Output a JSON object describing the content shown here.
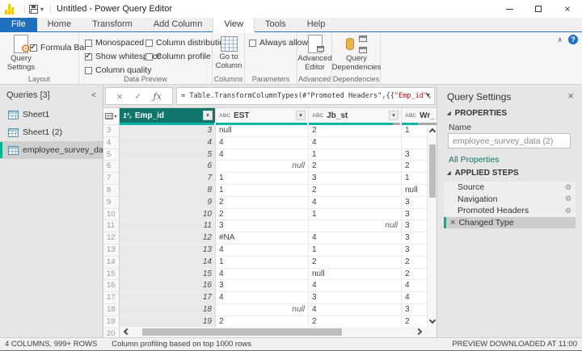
{
  "icons": {
    "dropdown": "▾",
    "check": "✓",
    "cancel": "×",
    "close": "×",
    "fx": "ƒx",
    "gear": "⚙",
    "help": "?",
    "section_triangle": "◢",
    "collapse_left": "<",
    "collapse_ribbon": "∧"
  },
  "title_bar": {
    "title": "Untitled - Power Query Editor"
  },
  "tabs": [
    {
      "label": "File",
      "type": "file"
    },
    {
      "label": "Home"
    },
    {
      "label": "Transform"
    },
    {
      "label": "Add Column"
    },
    {
      "label": "View",
      "active": true
    },
    {
      "label": "Tools"
    },
    {
      "label": "Help"
    }
  ],
  "ribbon": {
    "buttons": {
      "query_settings": "Query Settings",
      "go_to_column": "Go to Column",
      "advanced_editor": "Advanced Editor",
      "query_dependencies": "Query Dependencies"
    },
    "checkboxes": {
      "formula_bar": {
        "label": "Formula Bar",
        "checked": true
      },
      "monospaced": {
        "label": "Monospaced",
        "checked": false
      },
      "show_whitespace": {
        "label": "Show whitespace",
        "checked": true
      },
      "column_quality": {
        "label": "Column quality",
        "checked": false
      },
      "column_distribution": {
        "label": "Column distribution",
        "checked": false
      },
      "column_profile": {
        "label": "Column profile",
        "checked": false
      },
      "always_allow": {
        "label": "Always allow",
        "checked": false
      }
    },
    "groups": {
      "layout": "Layout",
      "data_preview": "Data Preview",
      "columns": "Columns",
      "parameters": "Parameters",
      "advanced": "Advanced",
      "dependencies": "Dependencies"
    }
  },
  "formula_bar": {
    "pre": "= Table.TransformColumnTypes(#\"Promoted Headers\",{{",
    "str": "\"Emp_id\"",
    "post": ", "
  },
  "queries_pane": {
    "header": "Queries [3]",
    "items": [
      {
        "label": "Sheet1",
        "selected": false
      },
      {
        "label": "Sheet1 (2)",
        "selected": false
      },
      {
        "label": "employee_survey_data (2)",
        "selected": true
      }
    ]
  },
  "grid": {
    "columns": [
      {
        "type_icon": "1²₃",
        "name": "Emp_id",
        "selected": true,
        "quality": "full"
      },
      {
        "type_icon": "ABC",
        "name": "EST",
        "quality": "full"
      },
      {
        "type_icon": "ABC",
        "name": "Jb_st",
        "quality": "gray-end"
      },
      {
        "type_icon": "ABC",
        "name": "Wr_",
        "quality": "gray-mid"
      }
    ],
    "rows": [
      {
        "n": "3",
        "emp": "3",
        "cells": [
          {
            "v": "null"
          },
          {
            "v": "2"
          },
          {
            "v": "1"
          }
        ]
      },
      {
        "n": "4",
        "emp": "4",
        "cells": [
          {
            "v": "4"
          },
          {
            "v": "4"
          },
          {
            "v": ""
          }
        ]
      },
      {
        "n": "5",
        "emp": "5",
        "cells": [
          {
            "v": "4"
          },
          {
            "v": "1"
          },
          {
            "v": "3"
          }
        ]
      },
      {
        "n": "6",
        "emp": "6",
        "cells": [
          {
            "v": "null",
            "nul": true
          },
          {
            "v": "2"
          },
          {
            "v": "2"
          }
        ]
      },
      {
        "n": "7",
        "emp": "7",
        "cells": [
          {
            "v": "1"
          },
          {
            "v": "3"
          },
          {
            "v": "1"
          }
        ]
      },
      {
        "n": "8",
        "emp": "8",
        "cells": [
          {
            "v": "1"
          },
          {
            "v": "2"
          },
          {
            "v": "null"
          }
        ]
      },
      {
        "n": "9",
        "emp": "9",
        "cells": [
          {
            "v": "2"
          },
          {
            "v": "4"
          },
          {
            "v": "3"
          }
        ]
      },
      {
        "n": "10",
        "emp": "10",
        "cells": [
          {
            "v": "2"
          },
          {
            "v": "1"
          },
          {
            "v": "3"
          }
        ]
      },
      {
        "n": "11",
        "emp": "11",
        "cells": [
          {
            "v": "3"
          },
          {
            "v": "null",
            "nul": true
          },
          {
            "v": "3"
          }
        ]
      },
      {
        "n": "12",
        "emp": "12",
        "cells": [
          {
            "v": "#NA"
          },
          {
            "v": "4"
          },
          {
            "v": "3"
          }
        ]
      },
      {
        "n": "13",
        "emp": "13",
        "cells": [
          {
            "v": "4"
          },
          {
            "v": "1"
          },
          {
            "v": "3"
          }
        ]
      },
      {
        "n": "14",
        "emp": "14",
        "cells": [
          {
            "v": "1"
          },
          {
            "v": "2"
          },
          {
            "v": "2"
          }
        ]
      },
      {
        "n": "15",
        "emp": "15",
        "cells": [
          {
            "v": "4"
          },
          {
            "v": "null"
          },
          {
            "v": "2"
          }
        ]
      },
      {
        "n": "16",
        "emp": "16",
        "cells": [
          {
            "v": "3"
          },
          {
            "v": "4"
          },
          {
            "v": "4"
          }
        ]
      },
      {
        "n": "17",
        "emp": "17",
        "cells": [
          {
            "v": "4"
          },
          {
            "v": "3"
          },
          {
            "v": "4"
          }
        ]
      },
      {
        "n": "18",
        "emp": "18",
        "cells": [
          {
            "v": "null",
            "nul": true
          },
          {
            "v": "4"
          },
          {
            "v": "3"
          }
        ]
      },
      {
        "n": "19",
        "emp": "19",
        "cells": [
          {
            "v": "2"
          },
          {
            "v": "2"
          },
          {
            "v": "2"
          }
        ]
      },
      {
        "n": "20",
        "emp": "",
        "cells": [
          {
            "v": ""
          },
          {
            "v": ""
          },
          {
            "v": ""
          }
        ]
      }
    ]
  },
  "query_settings": {
    "title": "Query Settings",
    "properties_header": "PROPERTIES",
    "name_label": "Name",
    "name_value": "employee_survey_data (2)",
    "all_properties": "All Properties",
    "applied_steps_header": "APPLIED STEPS",
    "steps": [
      {
        "label": "Source",
        "gear": true
      },
      {
        "label": "Navigation",
        "gear": true
      },
      {
        "label": "Promoted Headers",
        "gear": true
      },
      {
        "label": "Changed Type",
        "selected": true,
        "deletable": true
      }
    ]
  },
  "status_bar": {
    "left": "4 COLUMNS, 999+ ROWS",
    "middle": "Column profiling based on top 1000 rows",
    "right": "PREVIEW DOWNLOADED AT 11:00"
  },
  "colors": {
    "accent_teal": "#02b7a1",
    "selected_header_teal": "#12756b",
    "file_tab_blue": "#2170c0",
    "link_teal": "#0b7568",
    "string_literal_red": "#a31515"
  }
}
